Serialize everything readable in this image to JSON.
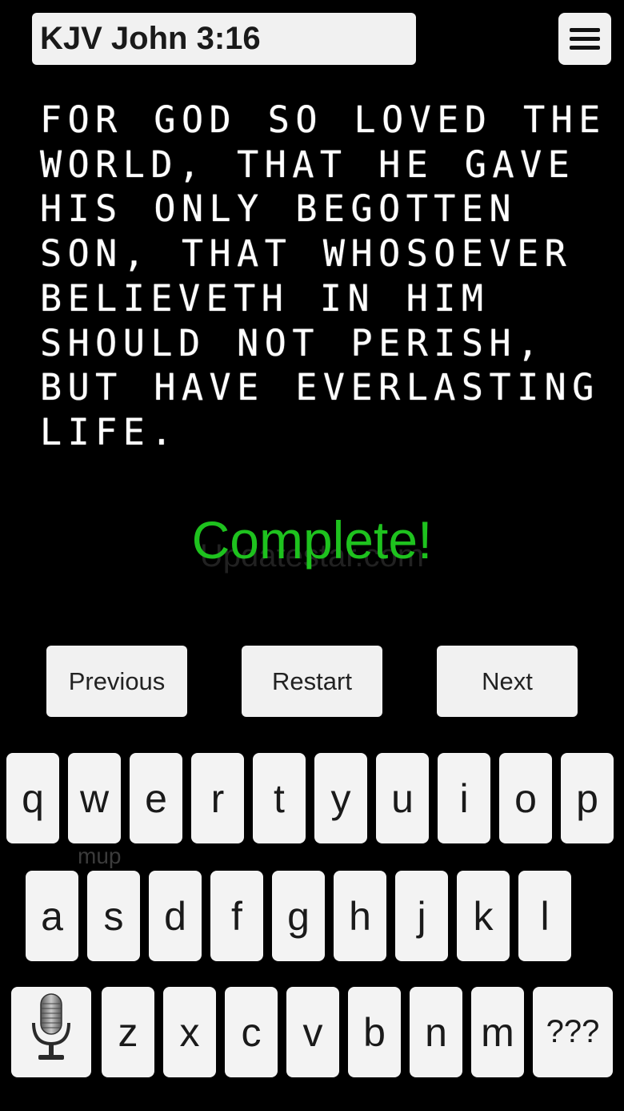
{
  "header": {
    "title": "KJV John 3:16"
  },
  "icons": {
    "menu": "hamburger-menu-icon",
    "mic": "microphone-icon"
  },
  "verse": {
    "lines": [
      "FOR GOD SO LOVED THE",
      "WORLD, THAT HE GAVE",
      "HIS ONLY BEGOTTEN",
      "SON, THAT WHOSOEVER",
      "BELIEVETH IN HIM",
      "SHOULD NOT PERISH,",
      "BUT HAVE EVERLASTING",
      "LIFE."
    ]
  },
  "status": {
    "text": "Complete!",
    "color": "#1ec21e"
  },
  "watermark": {
    "text": "Updatestar.com"
  },
  "nav": {
    "previous_label": "Previous",
    "restart_label": "Restart",
    "next_label": "Next"
  },
  "keyboard": {
    "row1": [
      "q",
      "w",
      "e",
      "r",
      "t",
      "y",
      "u",
      "i",
      "o",
      "p"
    ],
    "row2": [
      "a",
      "s",
      "d",
      "f",
      "g",
      "h",
      "j",
      "k",
      "l"
    ],
    "row3": [
      "z",
      "x",
      "c",
      "v",
      "b",
      "n",
      "m"
    ],
    "extra_key_label": "???",
    "hint": "mup"
  }
}
